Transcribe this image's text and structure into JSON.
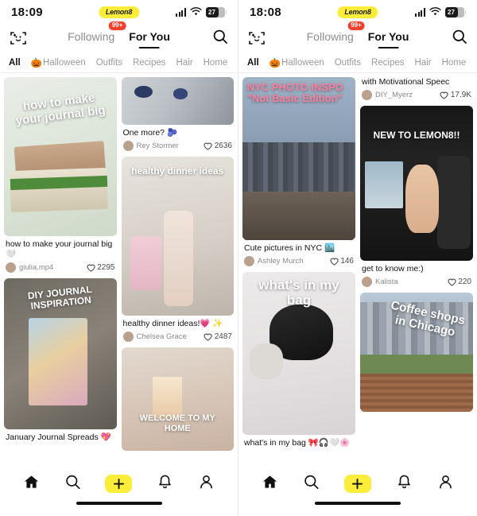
{
  "app": {
    "logo_text": "Lemon8",
    "accent": "#fced3a",
    "badge_color": "#f5402c"
  },
  "screens": [
    {
      "status": {
        "time": "18:09",
        "battery": "27"
      },
      "nav": {
        "face_scan": "face-scan-icon",
        "tabs": [
          {
            "label": "Following",
            "badge": "99+",
            "active": false
          },
          {
            "label": "For You",
            "badge": "",
            "active": true
          }
        ],
        "search": "search-icon"
      },
      "categories": [
        {
          "label": "All",
          "emoji": "",
          "active": true
        },
        {
          "label": "Halloween",
          "emoji": "🎃",
          "active": false
        },
        {
          "label": "Outfits",
          "emoji": "",
          "active": false
        },
        {
          "label": "Recipes",
          "emoji": "",
          "active": false
        },
        {
          "label": "Hair",
          "emoji": "",
          "active": false
        },
        {
          "label": "Home",
          "emoji": "",
          "active": false
        }
      ],
      "left_column": [
        {
          "overlay": "how to make your journal big",
          "caption": "how to make your journal big 🤍",
          "user": "giulia.mp4",
          "likes": "2295"
        },
        {
          "overlay": "DIY JOURNAL INSPIRATION",
          "caption": "January Journal Spreads 💖",
          "user": "",
          "likes": ""
        }
      ],
      "right_column": [
        {
          "overlay": "",
          "caption": "One more? 🫐",
          "user": "Rey Stormer",
          "likes": "2636"
        },
        {
          "overlay": "healthy dinner ideas",
          "caption": "healthy dinner ideas!💗 ✨",
          "user": "Chelsea Grace",
          "likes": "2487"
        },
        {
          "overlay": "WELCOME TO MY HOME",
          "caption": "",
          "user": "",
          "likes": ""
        }
      ]
    },
    {
      "status": {
        "time": "18:08",
        "battery": "27"
      },
      "nav": {
        "face_scan": "face-scan-icon",
        "tabs": [
          {
            "label": "Following",
            "badge": "99+",
            "active": false
          },
          {
            "label": "For You",
            "badge": "",
            "active": true
          }
        ],
        "search": "search-icon"
      },
      "categories": [
        {
          "label": "All",
          "emoji": "",
          "active": true
        },
        {
          "label": "Halloween",
          "emoji": "🎃",
          "active": false
        },
        {
          "label": "Outfits",
          "emoji": "",
          "active": false
        },
        {
          "label": "Recipes",
          "emoji": "",
          "active": false
        },
        {
          "label": "Hair",
          "emoji": "",
          "active": false
        },
        {
          "label": "Home",
          "emoji": "",
          "active": false
        }
      ],
      "left_column": [
        {
          "overlay": "NYC PHOTO INSPO \"Not Basic Edition\"",
          "caption": "Cute pictures in NYC 🏙️",
          "user": "Ashley Murch",
          "likes": "146"
        },
        {
          "overlay": "what's in my bag",
          "caption": "what's in my bag 🎀🎧🤍🌸",
          "user": "",
          "likes": ""
        }
      ],
      "right_column": [
        {
          "overlay": "",
          "caption": "with Motivational Speec",
          "user": "DIY_Myerz",
          "likes": "17.9K"
        },
        {
          "overlay": "NEW TO LEMON8!!",
          "caption": "get to know me:)",
          "user": "Kalista",
          "likes": "220"
        },
        {
          "overlay": "Coffee shops in Chicago",
          "caption": "",
          "user": "",
          "likes": ""
        }
      ]
    }
  ],
  "bottom_nav": [
    {
      "name": "home-icon",
      "label": "Home",
      "active": true
    },
    {
      "name": "search-icon",
      "label": "Search",
      "active": false
    },
    {
      "name": "plus-icon",
      "label": "Create",
      "active": false
    },
    {
      "name": "bell-icon",
      "label": "Notifications",
      "active": false
    },
    {
      "name": "person-icon",
      "label": "Profile",
      "active": false
    }
  ]
}
